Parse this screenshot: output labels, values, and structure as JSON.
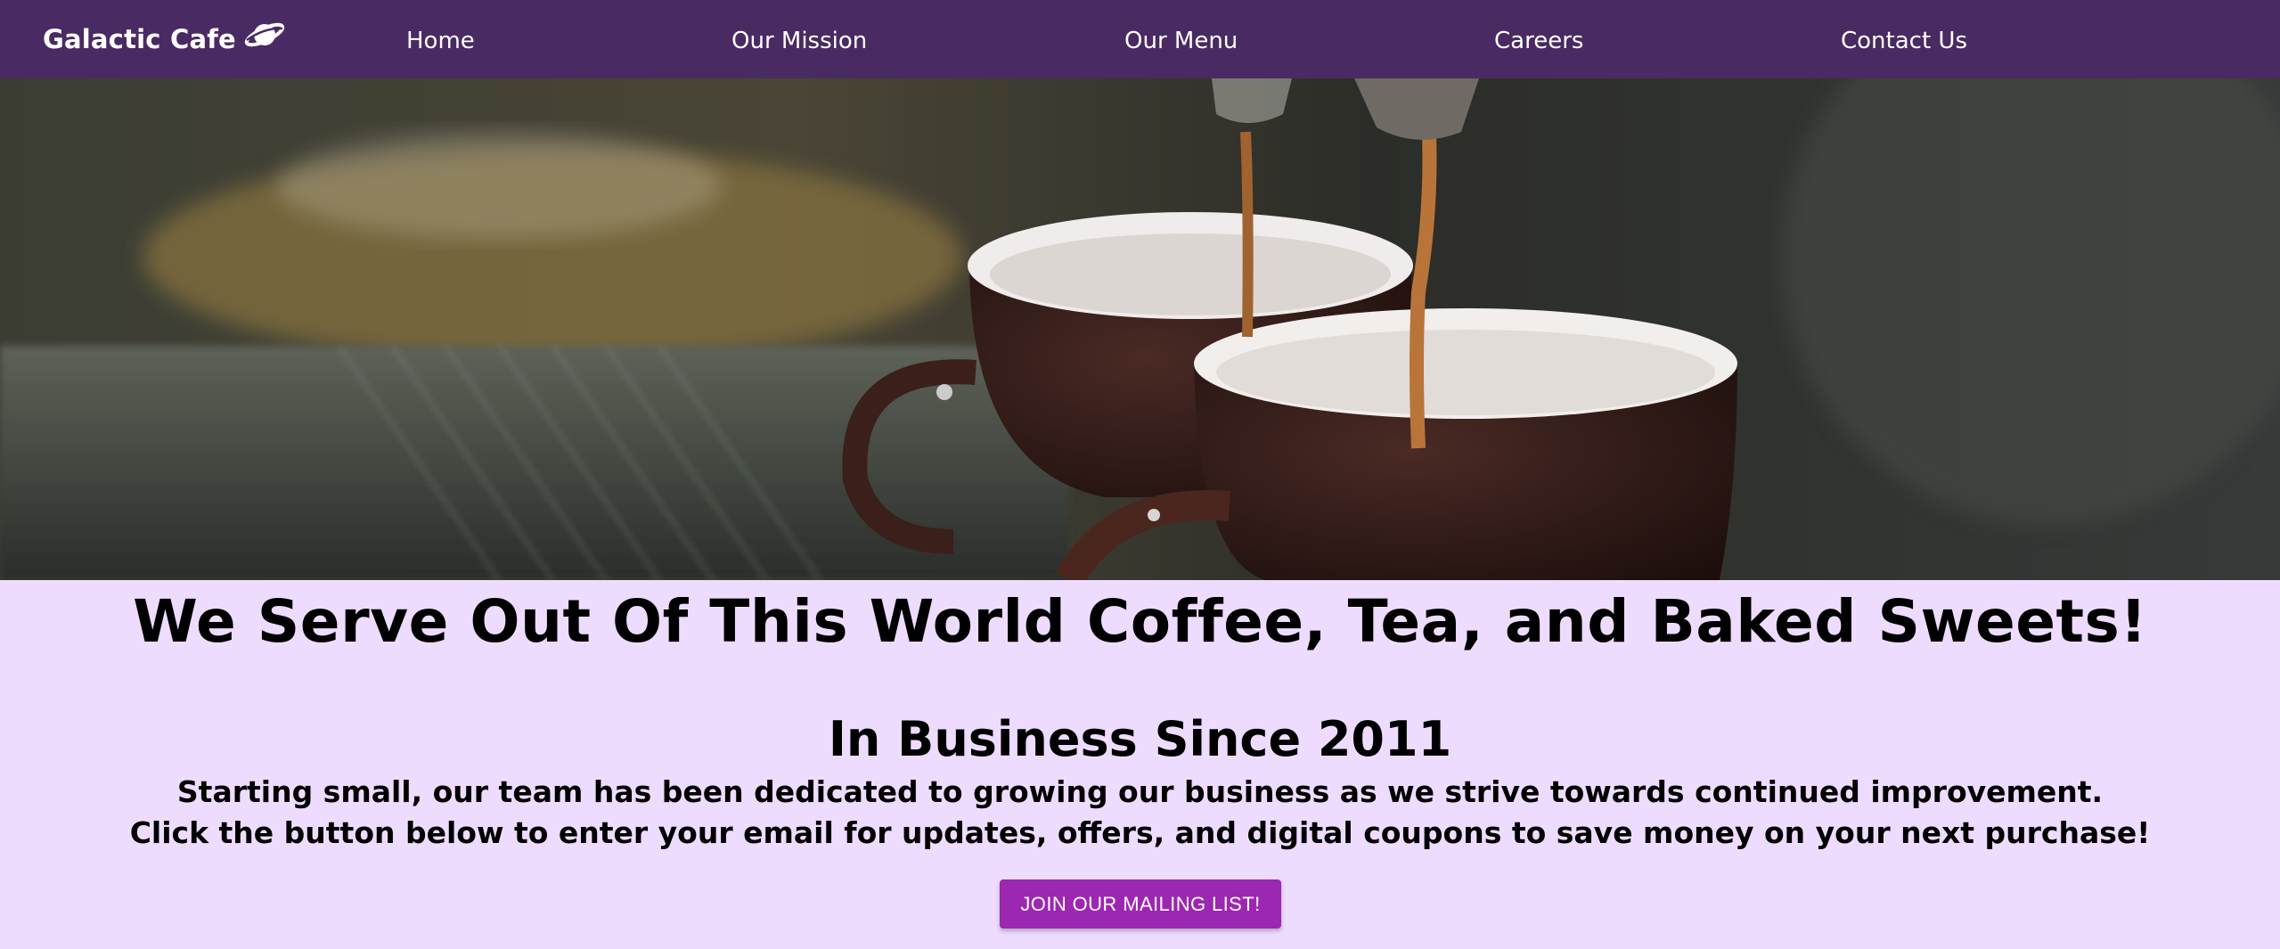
{
  "navbar": {
    "brand": "Galactic Cafe",
    "brand_icon": "planet-icon",
    "links": [
      "Home",
      "Our Mission",
      "Our Menu",
      "Careers",
      "Contact Us"
    ]
  },
  "hero": {
    "image": "espresso pouring into two brown cups"
  },
  "main": {
    "headline": "We Serve Out Of This World Coffee, Tea, and Baked Sweets!",
    "subheading": "In Business Since 2011",
    "paragraph_line1": "Starting small, our team has been dedicated to growing our business as we strive towards continued improvement.",
    "paragraph_line2": "Click the button below to enter your email for updates, offers, and digital coupons to save money on your next purchase!",
    "cta_label": "JOIN OUR MAILING LIST!"
  },
  "colors": {
    "navbar": "#4A2A62",
    "page_background": "#EEDCFF",
    "button": "#9C27B0",
    "text": "#000000"
  }
}
